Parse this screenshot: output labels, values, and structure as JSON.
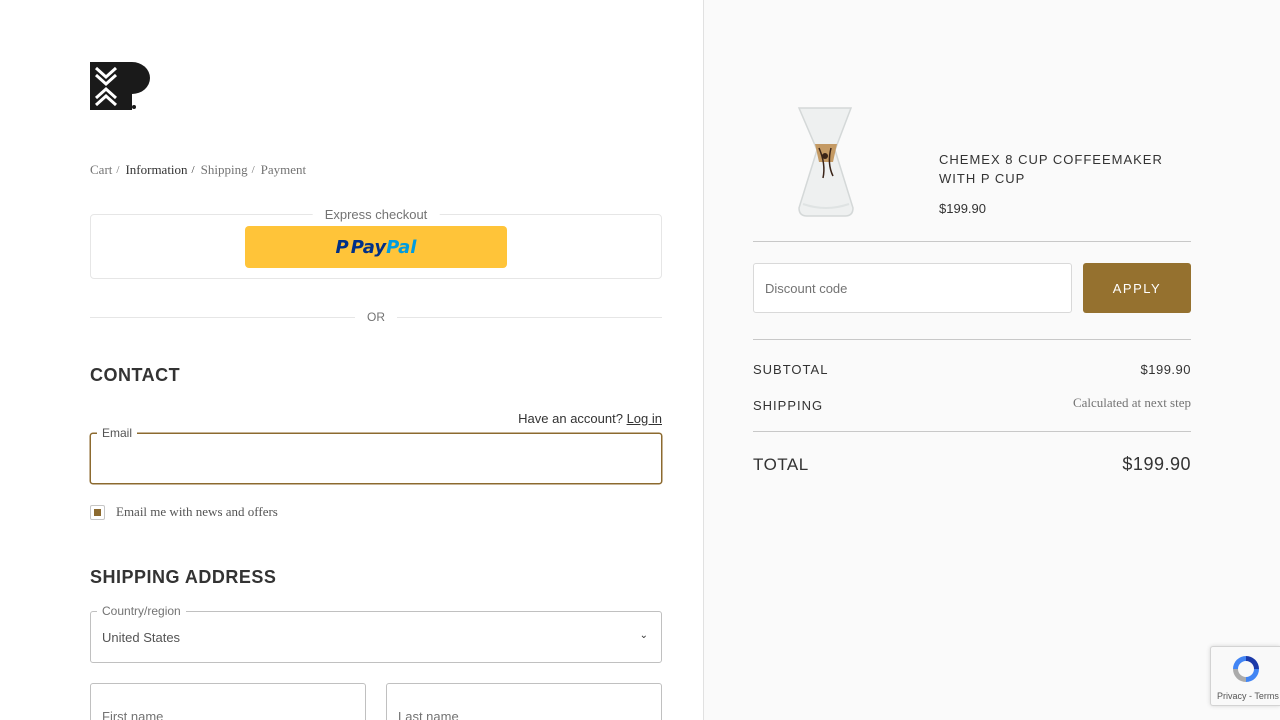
{
  "breadcrumb": [
    {
      "label": "Cart"
    },
    {
      "label": "Information"
    },
    {
      "label": "Shipping"
    },
    {
      "label": "Payment"
    }
  ],
  "express": {
    "label": "Express checkout",
    "paypal_mark": "P",
    "paypal_pay": "Pay",
    "paypal_pal": "Pal"
  },
  "divider": {
    "or": "OR"
  },
  "contact": {
    "title": "CONTACT",
    "have_account": "Have an account?",
    "login": "Log in",
    "email_label": "Email",
    "email_value": "",
    "newsletter_label": "Email me with news and offers",
    "newsletter_checked": true
  },
  "shipping": {
    "title": "SHIPPING ADDRESS",
    "country_label": "Country/region",
    "country_value": "United States",
    "first_name_placeholder": "First name",
    "last_name_placeholder": "Last name"
  },
  "summary": {
    "product": {
      "name": "CHEMEX 8 CUP COFFEEMAKER WITH P CUP",
      "price": "$199.90"
    },
    "discount_placeholder": "Discount code",
    "apply_label": "APPLY",
    "subtotal_label": "SUBTOTAL",
    "subtotal_value": "$199.90",
    "shipping_label": "SHIPPING",
    "shipping_value": "Calculated at next step",
    "total_label": "TOTAL",
    "total_value": "$199.90"
  },
  "recaptcha": {
    "privacy": "Privacy",
    "sep": " - ",
    "terms": "Terms"
  },
  "colors": {
    "accent": "#95712f",
    "paypal_yellow": "#ffc439",
    "paypal_blue": "#003087",
    "paypal_light_blue": "#009cde"
  }
}
